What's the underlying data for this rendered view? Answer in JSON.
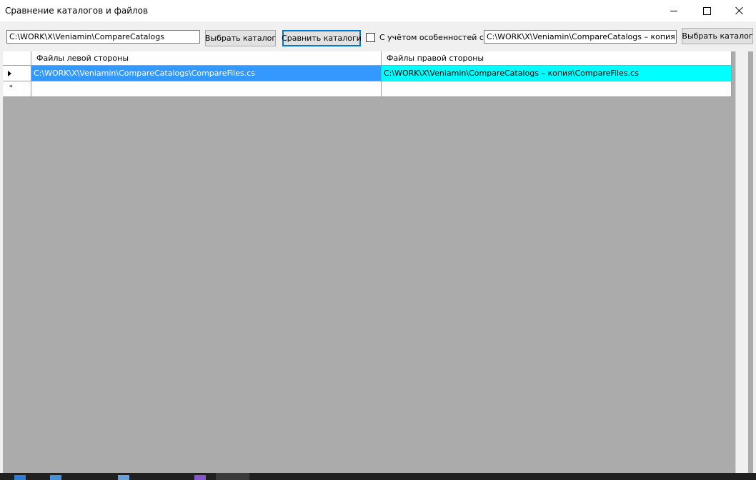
{
  "window": {
    "title": "Сравнение каталогов и файлов",
    "controls": {
      "minimize": "minimize",
      "maximize": "maximize",
      "close": "close"
    }
  },
  "toolbar": {
    "left_path": "C:\\WORK\\X\\Veniamin\\CompareCatalogs",
    "left_select_label": "Выбрать каталог",
    "compare_label": "Сравнить каталоги",
    "cs_option_label": "С учётом особенностей cs",
    "cs_option_checked": false,
    "right_path": "C:\\WORK\\X\\Veniamin\\CompareCatalogs – копия",
    "right_select_label": "Выбрать каталог"
  },
  "grid": {
    "columns": [
      "Файлы левой стороны",
      "Файлы правой стороны"
    ],
    "rows": [
      {
        "left": "C:\\WORK\\X\\Veniamin\\CompareCatalogs\\CompareFiles.cs",
        "right": "C:\\WORK\\X\\Veniamin\\CompareCatalogs – копия\\CompareFiles.cs",
        "indicator": "current-row-arrow"
      },
      {
        "left": "",
        "right": "",
        "indicator": "new-row-asterisk"
      }
    ],
    "new_row_symbol": "*"
  },
  "colors": {
    "selection": "#3399ff",
    "highlight": "#00ffff",
    "grid_background": "#ababab",
    "accent": "#0078d7"
  }
}
